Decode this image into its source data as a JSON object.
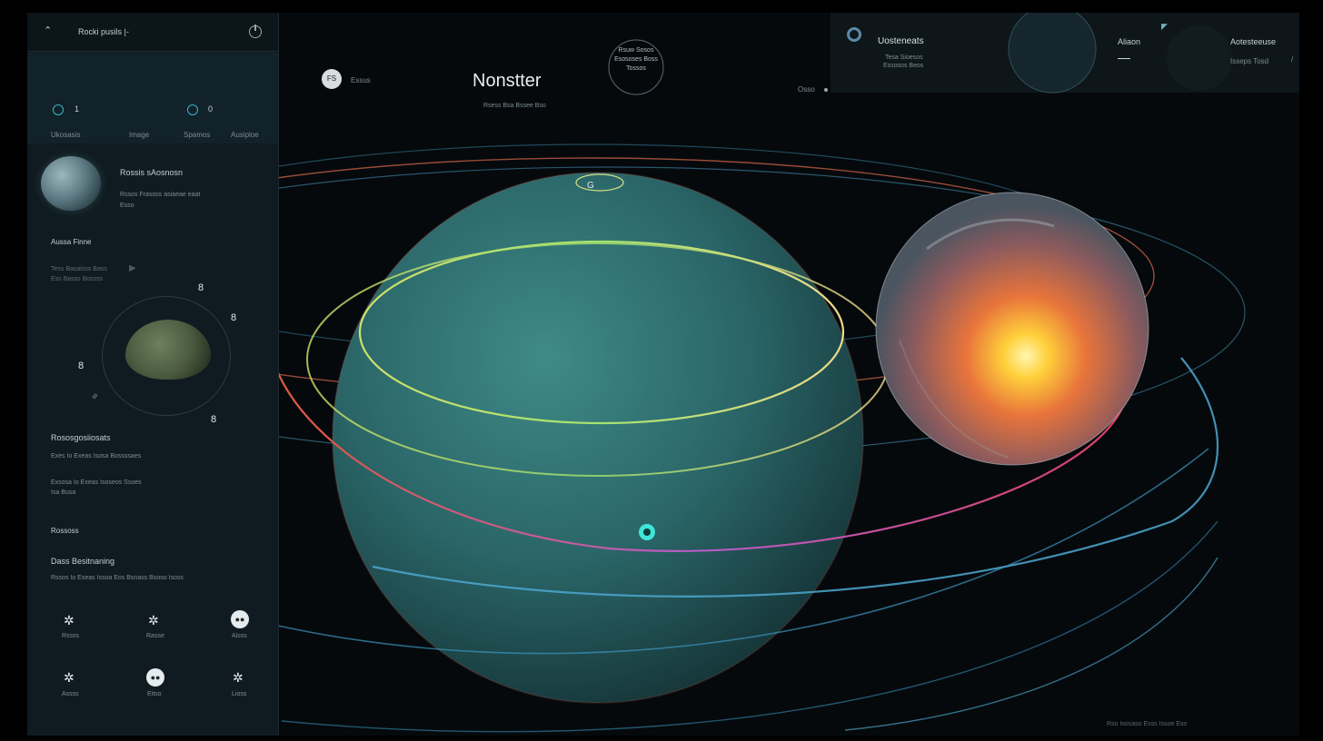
{
  "sidebar": {
    "header": {
      "title": "Rocki pusils |-",
      "back_icon": "caret-up-icon",
      "power_icon": "power-icon"
    },
    "stats": {
      "stat1_value": "1",
      "stat2_value": "0",
      "labels": [
        "Ukosasis",
        "Image",
        "Spamos",
        "Ausiploe"
      ]
    },
    "planet_card": {
      "title": "Rossis sAosnosn",
      "desc_line1": "Rssos Frasoss asiaeae eaat",
      "desc_line2": "Esso"
    },
    "section_title": "Aussa Finne",
    "list_line1": "Tess Basaisss Bass",
    "list_line2": "Ess Basss Bossss",
    "orbit_labels": [
      "8",
      "8",
      "8",
      "8",
      "8"
    ],
    "params": {
      "title": "Rososgosiiosats",
      "line1": "Exes Io Exeas Isosa Bossssaes",
      "line2": "Exsosa Io Exeas Isoseos Ssoes",
      "line3": "Isa Busa"
    },
    "sub_title": "Rossoss",
    "doc": {
      "title": "Dass Besitnaning",
      "line": "Rssos Io Eseas Issoa Eos Bsnass Bsoso Isoss"
    },
    "controls": [
      {
        "label": "Rssss"
      },
      {
        "label": "Rasse"
      },
      {
        "label": "Aisss"
      },
      {
        "label": "Assss"
      },
      {
        "label": "Eitso"
      },
      {
        "label": "Lioss"
      }
    ]
  },
  "header": {
    "avatar_text": "FS",
    "avatar_label": "Essus",
    "title": "Nonstter",
    "subtitle": "Rsess Bsa Bssee Bso",
    "badge_lines": [
      "Rsuw Sosos",
      "Esososes Boss",
      "Tossos"
    ],
    "status_text": "Osso"
  },
  "top_panel": {
    "name": "Uosteneats",
    "sub1": "Tesa Sioesos",
    "sub2": "Essosos Beos",
    "mid_label": "Aliaon",
    "right_title": "Aotesteeuse",
    "right_sub": "Isseps  Tosd"
  },
  "orbit_marker": "G",
  "footer_text": "Rso Isosaso Esss Issoe Eso",
  "colors": {
    "accent": "#3ee6d6",
    "teal_planet": "#2f6b6c",
    "orange": "#e8743b",
    "orbit_blue": "#4ea7cf",
    "orbit_red": "#c94a54"
  }
}
